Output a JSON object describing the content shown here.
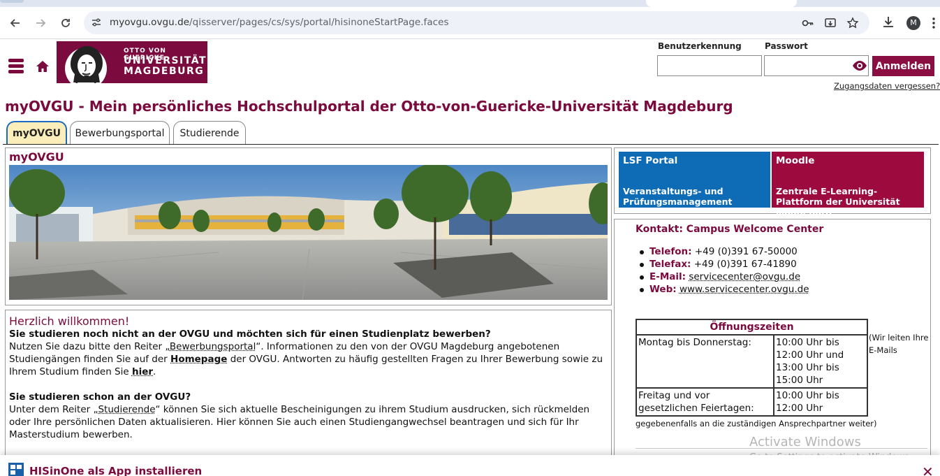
{
  "browser": {
    "url_host": "myovgu.ovgu.de",
    "url_path": "/qisserver/pages/cs/sys/portal/hisinoneStartPage.faces",
    "avatar_letter": "M"
  },
  "logo": {
    "line1": "OTTO VON GUERICKE",
    "line2": "UNIVERSITÄT",
    "line3": "MAGDEBURG"
  },
  "login": {
    "username_label": "Benutzerkennung",
    "password_label": "Passwort",
    "submit_label": "Anmelden",
    "forgot_label": "Zugangsdaten vergessen?"
  },
  "page_title": "myOVGU - Mein persönliches Hochschulportal der Otto-von-Guericke-Universität Magdeburg",
  "tabs": [
    {
      "label": "myOVGU",
      "active": true
    },
    {
      "label": "Bewerbungsportal",
      "active": false
    },
    {
      "label": "Studierende",
      "active": false
    }
  ],
  "image_panel": {
    "title": "myOVGU"
  },
  "welcome": {
    "title": "Herzlich willkommen!",
    "q1": "Sie studieren noch nicht an der OVGU und möchten sich für einen Studienplatz bewerben?",
    "p1_a": "Nutzen Sie dazu bitte den Reiter „",
    "p1_link1": "Bewerbungsportal",
    "p1_b": "“. Informationen zu den von der OVGU Magdeburg angebotenen Studiengängen finden Sie auf der ",
    "p1_link2": "Homepage",
    "p1_c": " der OVGU. Antworten zu häufig gestellten Fragen zu Ihrer Bewerbung sowie zu Ihrem Studium finden Sie ",
    "p1_link3": "hier",
    "p1_d": ".",
    "q2": "Sie studieren schon an der OVGU?",
    "p2_a": "Unter dem Reiter „",
    "p2_link": "Studierende",
    "p2_b": "“ können Sie sich aktuelle Bescheinigungen zu ihrem Studium ausdrucken, sich rückmelden oder Ihre persönlichen Daten aktualisieren. Hier können Sie auch einen Studiengangwechsel beantragen und sich für Ihr Masterstudium bewerben."
  },
  "portals": [
    {
      "title": "LSF Portal",
      "subtitle": "Veranstaltungs- und Prüfungsmanagement",
      "color": "#0e6cb6"
    },
    {
      "title": "Moodle",
      "subtitle": "Zentrale E-Learning-Plattform der Universität Magdeburg",
      "color": "#9c0a3e"
    }
  ],
  "contact": {
    "title": "Kontakt: Campus Welcome Center",
    "rows": [
      {
        "label": "Telefon:",
        "value": "+49 (0)391 67-50000"
      },
      {
        "label": "Telefax:",
        "value": "+49 (0)391 67-41890"
      },
      {
        "label": "E-Mail:",
        "value": "servicecenter@ovgu.de"
      },
      {
        "label": "Web:",
        "value": "www.servicecenter.ovgu.de"
      }
    ],
    "hours_title": "Öffnungszeiten",
    "hours": [
      {
        "days": "Montag bis Donnerstag:",
        "time1": "10:00 Uhr bis 12:00 Uhr und",
        "time2": "13:00 Uhr bis 15:00 Uhr"
      },
      {
        "days": "Freitag und vor gesetzlichen Feiertagen:",
        "time1": "10:00 Uhr bis 12:00 Uhr",
        "time2": ""
      }
    ],
    "side_note": "(Wir leiten Ihre E-Mails",
    "bottom_note": "gegebenenfalls an die zuständigen Ansprechpartner weiter)"
  },
  "app_banner": {
    "text": "HISinOne als App installieren",
    "close": "✕"
  },
  "watermark": {
    "line1": "Activate Windows",
    "line2": "Go to Settings to activate Windows."
  },
  "colors": {
    "brand": "#7b0a3e",
    "lsf": "#0e6cb6",
    "moodle": "#9c0a3e",
    "active_tab": "#fbeebb"
  }
}
